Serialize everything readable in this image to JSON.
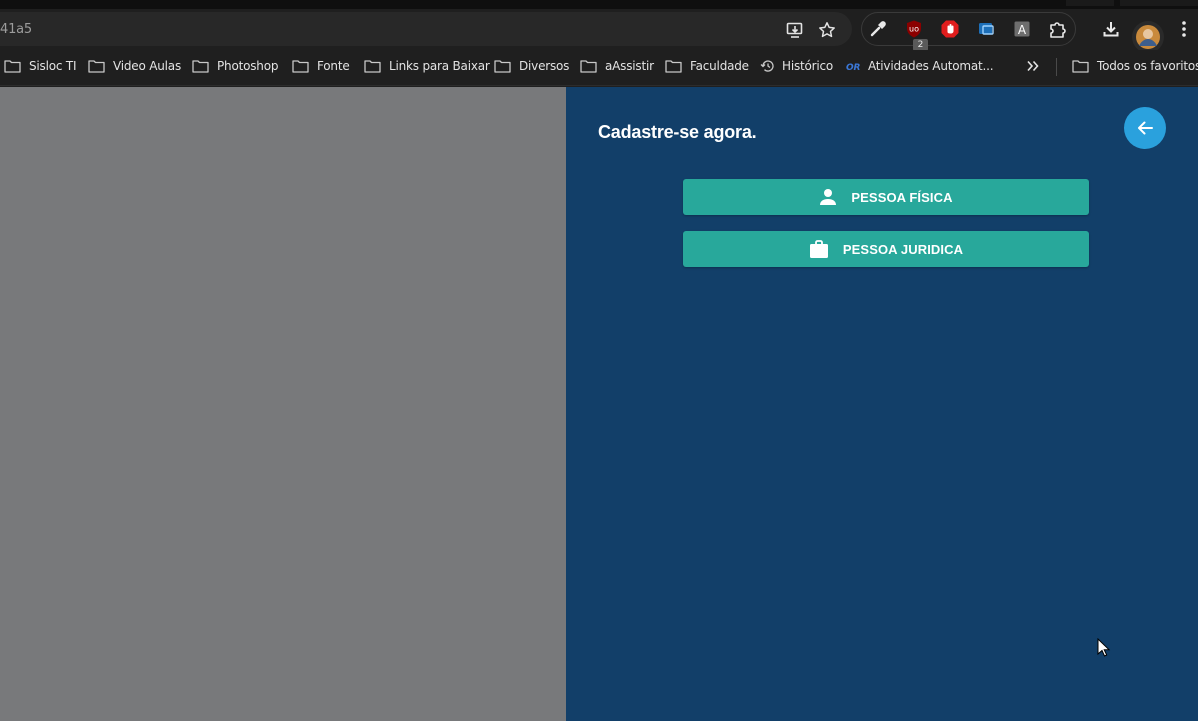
{
  "browser": {
    "url_fragment": "41a5",
    "extension_badge": "2",
    "bookmarks": [
      {
        "label": "Sisloc TI",
        "icon": "folder-icon"
      },
      {
        "label": "Video Aulas",
        "icon": "folder-icon"
      },
      {
        "label": "Photoshop",
        "icon": "folder-icon"
      },
      {
        "label": "Fonte",
        "icon": "folder-icon"
      },
      {
        "label": "Links para Baixar",
        "icon": "folder-icon"
      },
      {
        "label": "Diversos",
        "icon": "folder-icon"
      },
      {
        "label": "aAssistir",
        "icon": "folder-icon"
      },
      {
        "label": "Faculdade",
        "icon": "folder-icon"
      },
      {
        "label": "Histórico",
        "icon": "history-icon"
      },
      {
        "label": "Atividades Automat...",
        "icon": "or-logo-icon"
      }
    ],
    "all_bookmarks_label": "Todos os favoritos"
  },
  "page": {
    "heading": "Cadastre-se agora.",
    "buttons": {
      "pessoa_fisica": "PESSOA FÍSICA",
      "pessoa_juridica": "PESSOA JURIDICA"
    }
  },
  "colors": {
    "panel": "#123f69",
    "overlay": "#78797b",
    "button": "#28a89b",
    "back_button": "#2aa1dd"
  }
}
